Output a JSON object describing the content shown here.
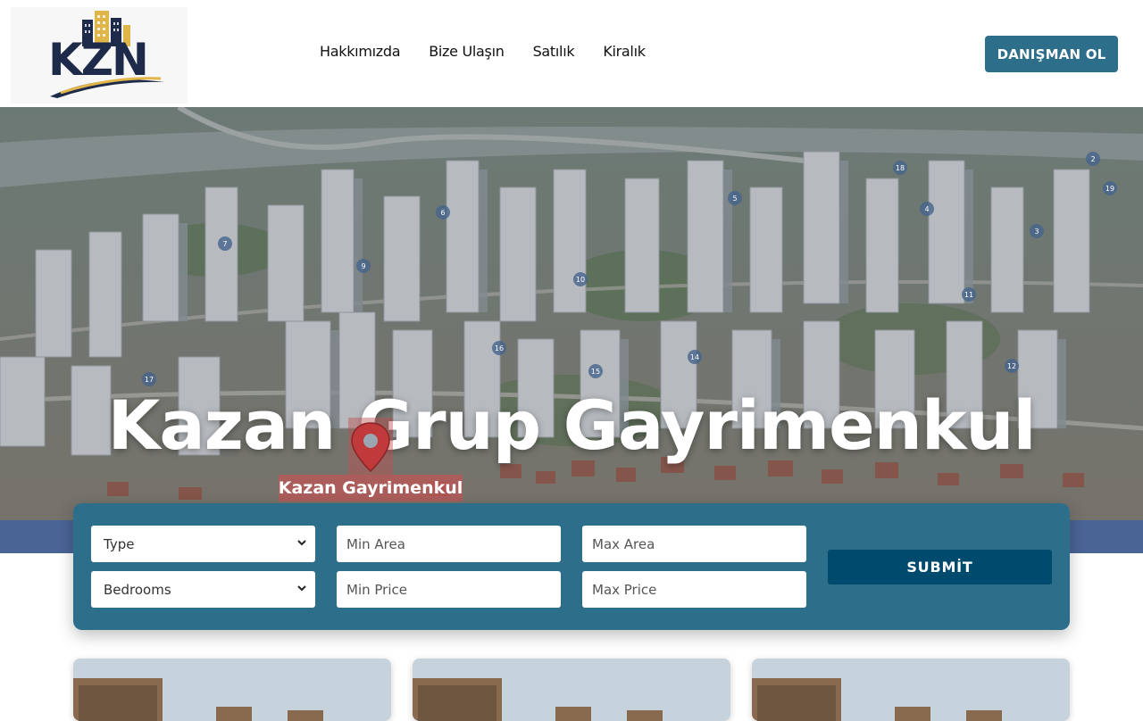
{
  "header": {
    "logo_text": "KZN",
    "nav": [
      {
        "label": "Hakkımızda"
      },
      {
        "label": "Bize Ulaşın"
      },
      {
        "label": "Satılık"
      },
      {
        "label": "Kiralık"
      }
    ],
    "cta_label": "DANIŞMAN OL"
  },
  "hero": {
    "title": "Kazan Grup Gayrimenkul",
    "pin_label": "Kazan Gayrimenkul",
    "map_numbers": [
      "2",
      "3",
      "4",
      "5",
      "6",
      "7",
      "9",
      "10",
      "11",
      "12",
      "14",
      "15",
      "16",
      "17",
      "18",
      "19"
    ]
  },
  "search": {
    "type_select": "Type",
    "bedrooms_select": "Bedrooms",
    "min_area_placeholder": "Min Area",
    "max_area_placeholder": "Max Area",
    "min_price_placeholder": "Min Price",
    "max_price_placeholder": "Max Price",
    "submit_label": "SUBMİT"
  },
  "colors": {
    "accent": "#2d6e8a",
    "submit": "#004a6e",
    "band": "#4a6496"
  }
}
